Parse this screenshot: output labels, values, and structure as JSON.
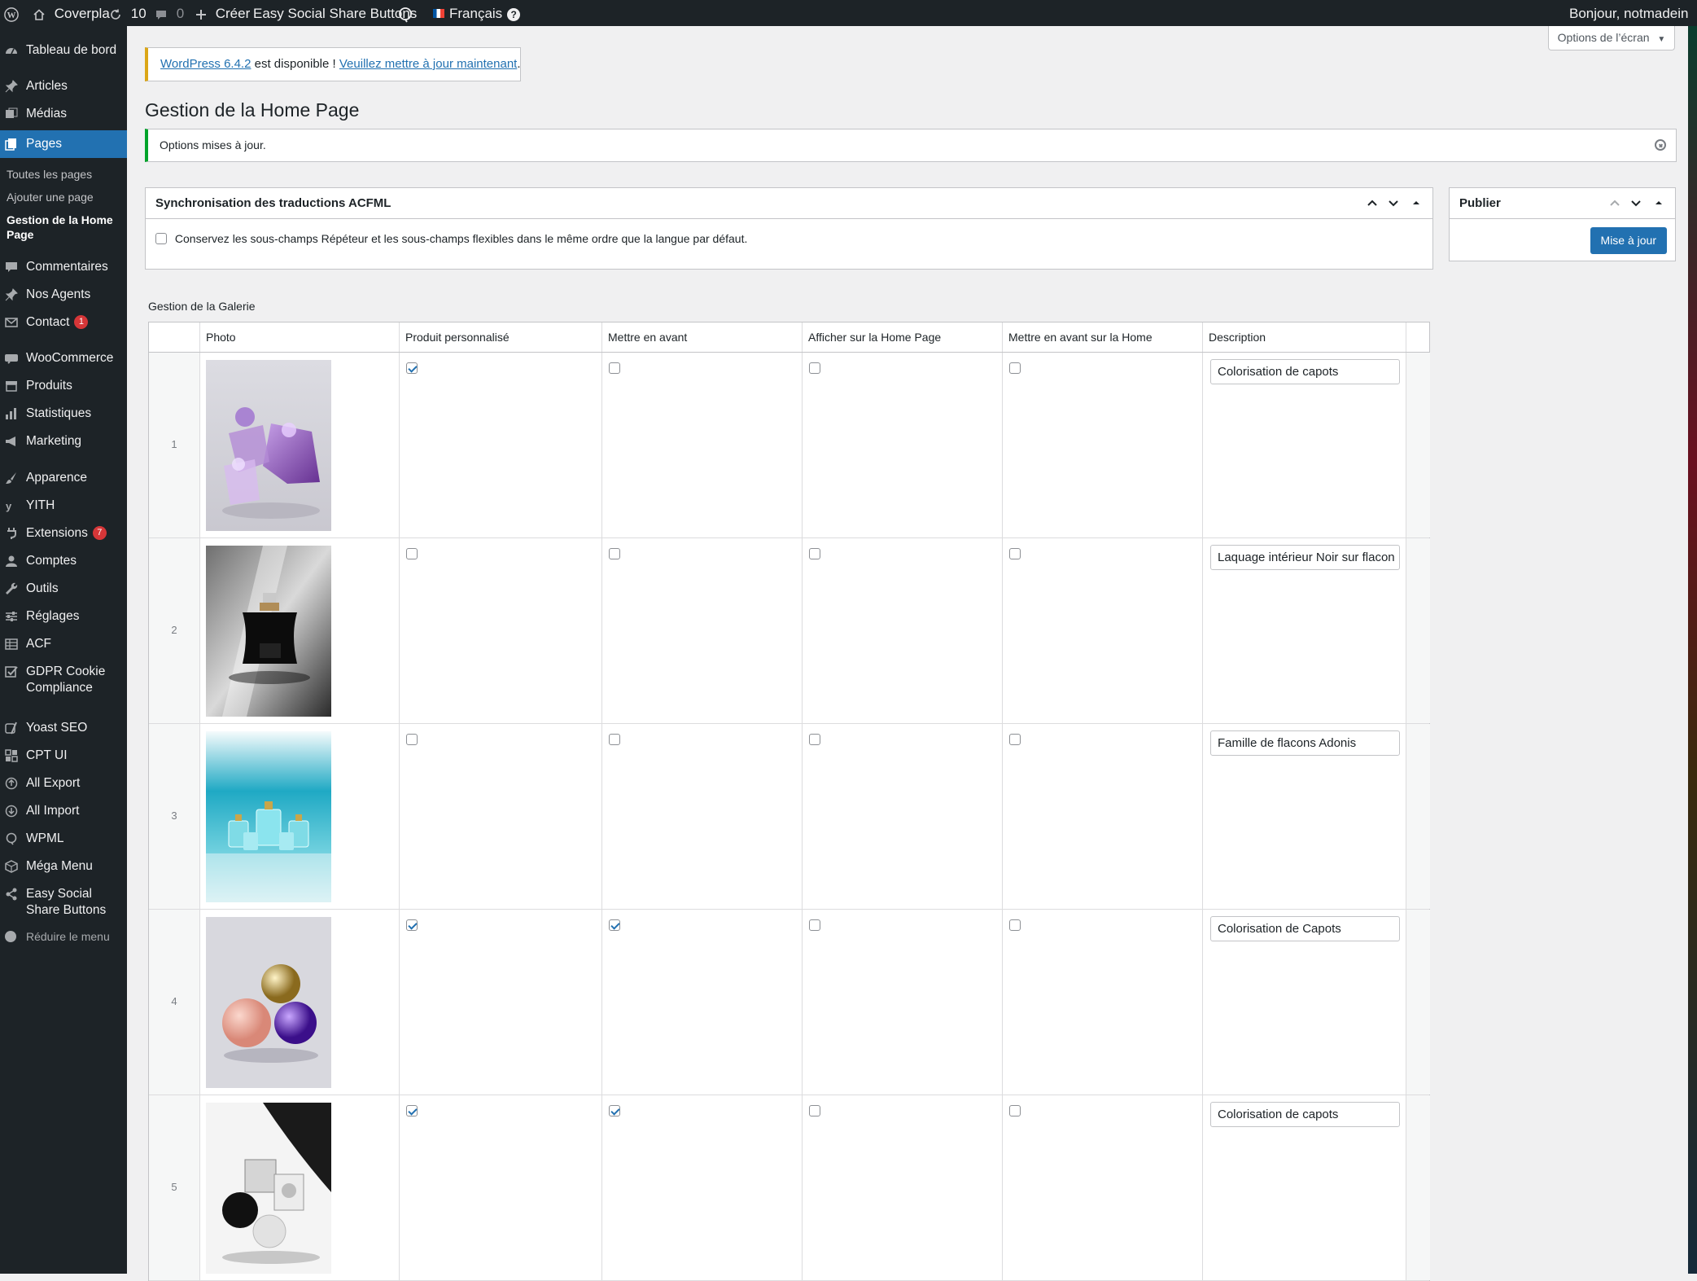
{
  "adminbar": {
    "site_name": "Coverpla",
    "updates_count": "10",
    "comments_count": "0",
    "new_label": "Créer",
    "plugin_link": "Easy Social Share Buttons",
    "language": "Français",
    "help": "?",
    "greeting": "Bonjour, notmadein"
  },
  "sidebar": {
    "dashboard": "Tableau de bord",
    "posts": "Articles",
    "media": "Médias",
    "pages": "Pages",
    "pages_sub": [
      "Toutes les pages",
      "Ajouter une page",
      "Gestion de la Home Page"
    ],
    "comments": "Commentaires",
    "agents": "Nos Agents",
    "contact": "Contact",
    "contact_badge": "1",
    "woocommerce": "WooCommerce",
    "products": "Produits",
    "stats": "Statistiques",
    "marketing": "Marketing",
    "appearance": "Apparence",
    "yith": "YITH",
    "plugins": "Extensions",
    "plugins_badge": "7",
    "users": "Comptes",
    "tools": "Outils",
    "settings": "Réglages",
    "acf": "ACF",
    "gdpr": "GDPR Cookie Compliance",
    "yoast": "Yoast SEO",
    "cptui": "CPT UI",
    "all_export": "All Export",
    "all_import": "All Import",
    "wpml": "WPML",
    "mega_menu": "Méga Menu",
    "essb": "Easy Social Share Buttons",
    "collapse": "Réduire le menu"
  },
  "screen_options": "Options de l’écran",
  "update_notice": {
    "version_link": "WordPress 6.4.2",
    "middle": "est disponible !",
    "update_link": "Veuillez mettre à jour maintenant",
    "end": "."
  },
  "page_title": "Gestion de la Home Page",
  "success_notice": "Options mises à jour.",
  "sync_box": {
    "title": "Synchronisation des traductions ACFML",
    "checkbox_label": "Conservez les sous-champs Répéteur et les sous-champs flexibles dans le même ordre que la langue par défaut.",
    "checked": false
  },
  "publish_box": {
    "title": "Publier",
    "button": "Mise à jour"
  },
  "gallery": {
    "label": "Gestion de la Galerie",
    "columns": [
      "Photo",
      "Produit personnalisé",
      "Mettre en avant",
      "Afficher sur la Home Page",
      "Mettre en avant sur la Home",
      "Description"
    ],
    "rows": [
      {
        "num": "1",
        "photo": "purple-glass-cubes",
        "custom": true,
        "featured": false,
        "show_home": false,
        "featured_home": false,
        "description": "Colorisation de capots"
      },
      {
        "num": "2",
        "photo": "black-perfume-bottle",
        "custom": false,
        "featured": false,
        "show_home": false,
        "featured_home": false,
        "description": "Laquage intérieur Noir sur flacon"
      },
      {
        "num": "3",
        "photo": "turquoise-bottle-family",
        "custom": false,
        "featured": false,
        "show_home": false,
        "featured_home": false,
        "description": "Famille de flacons Adonis"
      },
      {
        "num": "4",
        "photo": "colored-glass-spheres",
        "custom": true,
        "featured": true,
        "show_home": false,
        "featured_home": false,
        "description": "Colorisation de Capots"
      },
      {
        "num": "5",
        "photo": "monochrome-caps",
        "custom": true,
        "featured": true,
        "show_home": false,
        "featured_home": false,
        "description": "Colorisation de capots"
      }
    ]
  }
}
